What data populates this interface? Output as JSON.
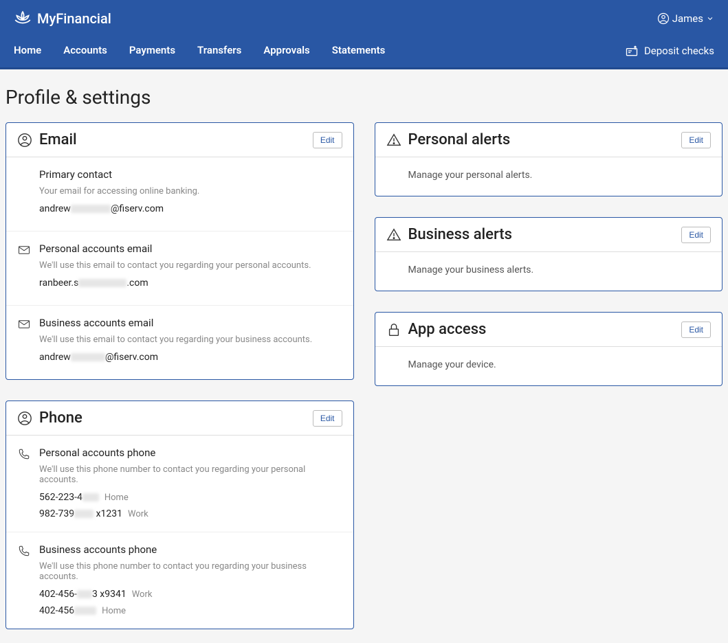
{
  "brand": "MyFinancial",
  "user": "James",
  "nav": {
    "items": [
      "Home",
      "Accounts",
      "Payments",
      "Transfers",
      "Approvals",
      "Statements"
    ],
    "deposit": "Deposit checks"
  },
  "page_title": "Profile & settings",
  "edit_label": "Edit",
  "email_card": {
    "title": "Email",
    "primary": {
      "title": "Primary contact",
      "desc": "Your email for accessing online banking.",
      "value_prefix": "andrew",
      "value_suffix": "@fiserv.com"
    },
    "personal": {
      "title": "Personal accounts email",
      "desc": "We'll use this email to contact you regarding your personal accounts.",
      "value_prefix": "ranbeer.s",
      "value_suffix": ".com"
    },
    "business": {
      "title": "Business accounts email",
      "desc": "We'll use this email to contact you regarding your business accounts.",
      "value_prefix": "andrew",
      "value_suffix": "@fiserv.com"
    }
  },
  "phone_card": {
    "title": "Phone",
    "personal": {
      "title": "Personal accounts phone",
      "desc": "We'll use this phone number to contact you regarding your personal accounts.",
      "entries": [
        {
          "prefix": "562-223-4",
          "suffix": "",
          "label": "Home"
        },
        {
          "prefix": "982-739",
          "suffix": "x1231",
          "label": "Work"
        }
      ]
    },
    "business": {
      "title": "Business accounts phone",
      "desc": "We'll use this phone number to contact you regarding your business accounts.",
      "entries": [
        {
          "prefix": "402-456-",
          "suffix": "3 x9341",
          "label": "Work"
        },
        {
          "prefix": "402-456",
          "suffix": "",
          "label": "Home"
        }
      ]
    }
  },
  "personal_alerts": {
    "title": "Personal alerts",
    "body": "Manage your personal alerts."
  },
  "business_alerts": {
    "title": "Business alerts",
    "body": "Manage your business alerts."
  },
  "app_access": {
    "title": "App access",
    "body": "Manage your device."
  }
}
